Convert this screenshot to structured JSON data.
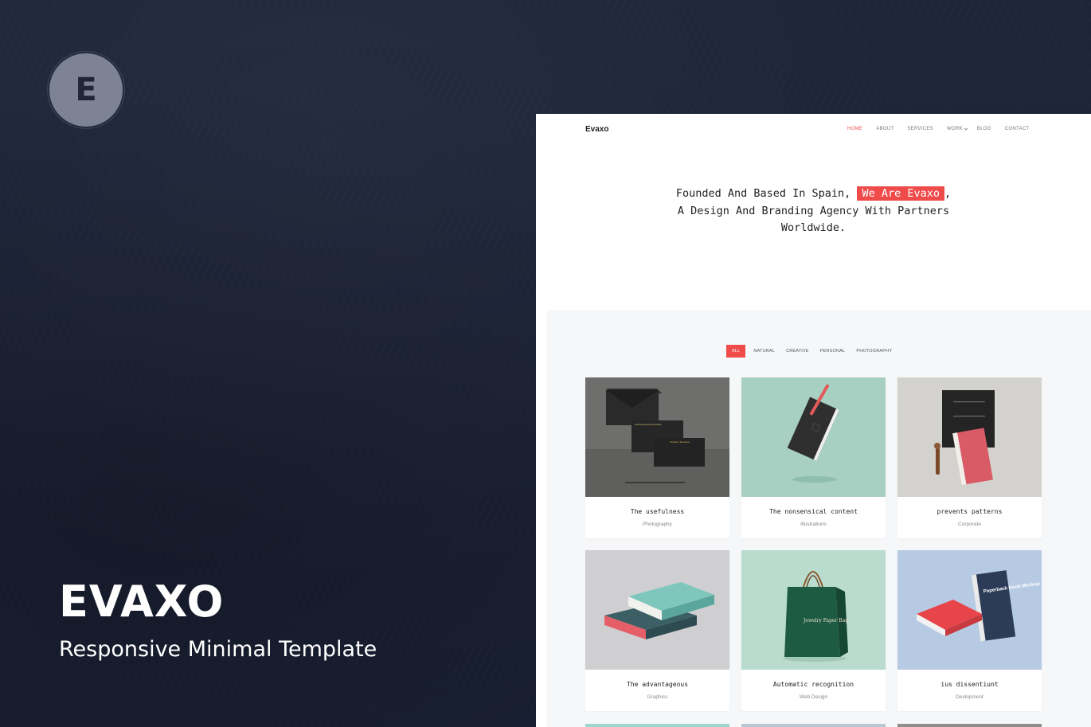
{
  "badge": {
    "letter": "E"
  },
  "brand": {
    "title": "EVAXO",
    "subtitle": "Responsive Minimal Template"
  },
  "site": {
    "logo": "Evaxo",
    "nav": [
      {
        "label": "HOME",
        "active": true
      },
      {
        "label": "ABOUT"
      },
      {
        "label": "SERVICES"
      },
      {
        "label": "WORK"
      },
      {
        "label": "BLOG"
      },
      {
        "label": "CONTACT"
      }
    ],
    "hero": {
      "line1_before": "Founded And Based In Spain, ",
      "highlight": "We Are Evaxo",
      "line1_after": ",",
      "line2": "A Design And Branding Agency With Partners",
      "line3": "Worldwide."
    },
    "filters": [
      "ALL",
      "NATURAL",
      "CREATIVE",
      "PERSONAL",
      "PHOTOGRAPHY"
    ],
    "cards": [
      {
        "title": "The usefulness",
        "category": "Photography"
      },
      {
        "title": "The nonsensical content",
        "category": "Illustrations"
      },
      {
        "title": "prevents patterns",
        "category": "Corporate"
      },
      {
        "title": "The advantageous",
        "category": "Graphics"
      },
      {
        "title": "Automatic recognition",
        "category": "Web Design"
      },
      {
        "title": "ius dissentiunt",
        "category": "Devlopment"
      }
    ],
    "mockup_text": {
      "envelope": "Announcement Envelope",
      "envelope2": "Invitation Envelope",
      "bag": "Jewelry Paper Bag",
      "book": "Paperback Book Mockup"
    }
  },
  "colors": {
    "accent": "#ef4b4b",
    "background": "#1c2338"
  }
}
